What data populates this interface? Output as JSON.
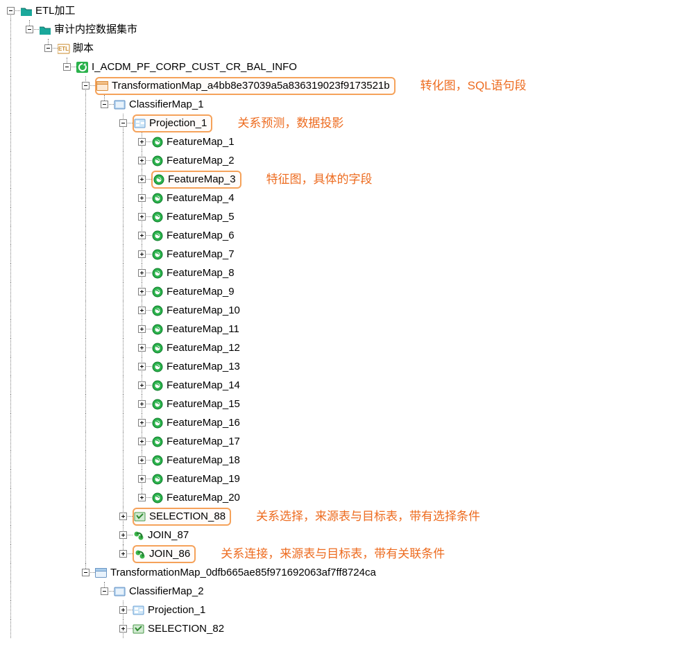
{
  "tree": {
    "root": {
      "label": "ETL加工"
    },
    "l1": {
      "label": "审计内控数据集市"
    },
    "l2": {
      "label": "脚本"
    },
    "l3": {
      "label": "I_ACDM_PF_CORP_CUST_CR_BAL_INFO"
    },
    "tmap1": {
      "label": "TransformationMap_a4bb8e37039a5a836319023f9173521b"
    },
    "cmap1": {
      "label": "ClassifierMap_1"
    },
    "proj1": {
      "label": "Projection_1"
    },
    "features": [
      "FeatureMap_1",
      "FeatureMap_2",
      "FeatureMap_3",
      "FeatureMap_4",
      "FeatureMap_5",
      "FeatureMap_6",
      "FeatureMap_7",
      "FeatureMap_8",
      "FeatureMap_9",
      "FeatureMap_10",
      "FeatureMap_11",
      "FeatureMap_12",
      "FeatureMap_13",
      "FeatureMap_14",
      "FeatureMap_15",
      "FeatureMap_16",
      "FeatureMap_17",
      "FeatureMap_18",
      "FeatureMap_19",
      "FeatureMap_20"
    ],
    "sel88": {
      "label": "SELECTION_88"
    },
    "join87": {
      "label": "JOIN_87"
    },
    "join86": {
      "label": "JOIN_86"
    },
    "tmap2": {
      "label": "TransformationMap_0dfb665ae85f971692063af7ff8724ca"
    },
    "cmap2": {
      "label": "ClassifierMap_2"
    },
    "proj2": {
      "label": "Projection_1"
    },
    "sel82": {
      "label": "SELECTION_82"
    }
  },
  "annot": {
    "tmap": "转化图，SQL语句段",
    "proj": "关系预测，数据投影",
    "feat": "特征图，具体的字段",
    "sel": "关系选择，来源表与目标表，带有选择条件",
    "join": "关系连接，来源表与目标表，带有关联条件"
  }
}
